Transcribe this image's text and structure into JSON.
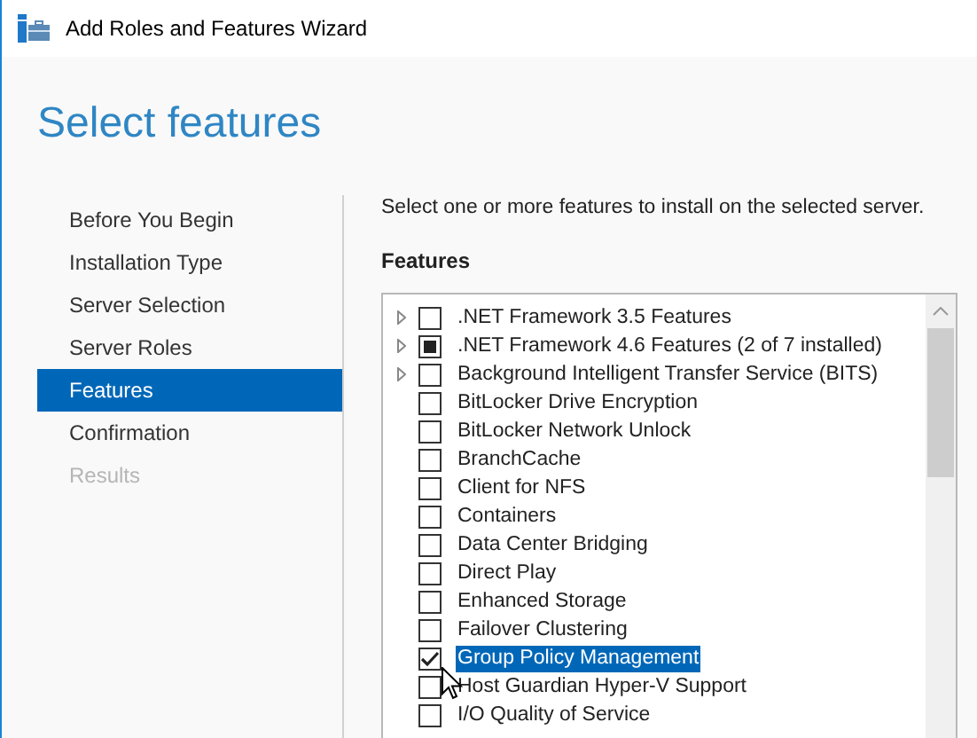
{
  "window": {
    "title": "Add Roles and Features Wizard"
  },
  "heading": "Select features",
  "steps": [
    {
      "label": "Before You Begin",
      "selected": false,
      "disabled": false
    },
    {
      "label": "Installation Type",
      "selected": false,
      "disabled": false
    },
    {
      "label": "Server Selection",
      "selected": false,
      "disabled": false
    },
    {
      "label": "Server Roles",
      "selected": false,
      "disabled": false
    },
    {
      "label": "Features",
      "selected": true,
      "disabled": false
    },
    {
      "label": "Confirmation",
      "selected": false,
      "disabled": false
    },
    {
      "label": "Results",
      "selected": false,
      "disabled": true
    }
  ],
  "description": "Select one or more features to install on the selected server.",
  "features_label": "Features",
  "features": [
    {
      "label": ".NET Framework 3.5 Features",
      "expandable": true,
      "checked": false,
      "partial": false,
      "selected": false
    },
    {
      "label": ".NET Framework 4.6 Features (2 of 7 installed)",
      "expandable": true,
      "checked": false,
      "partial": true,
      "selected": false
    },
    {
      "label": "Background Intelligent Transfer Service (BITS)",
      "expandable": true,
      "checked": false,
      "partial": false,
      "selected": false
    },
    {
      "label": "BitLocker Drive Encryption",
      "expandable": false,
      "checked": false,
      "partial": false,
      "selected": false
    },
    {
      "label": "BitLocker Network Unlock",
      "expandable": false,
      "checked": false,
      "partial": false,
      "selected": false
    },
    {
      "label": "BranchCache",
      "expandable": false,
      "checked": false,
      "partial": false,
      "selected": false
    },
    {
      "label": "Client for NFS",
      "expandable": false,
      "checked": false,
      "partial": false,
      "selected": false
    },
    {
      "label": "Containers",
      "expandable": false,
      "checked": false,
      "partial": false,
      "selected": false
    },
    {
      "label": "Data Center Bridging",
      "expandable": false,
      "checked": false,
      "partial": false,
      "selected": false
    },
    {
      "label": "Direct Play",
      "expandable": false,
      "checked": false,
      "partial": false,
      "selected": false
    },
    {
      "label": "Enhanced Storage",
      "expandable": false,
      "checked": false,
      "partial": false,
      "selected": false
    },
    {
      "label": "Failover Clustering",
      "expandable": false,
      "checked": false,
      "partial": false,
      "selected": false
    },
    {
      "label": "Group Policy Management",
      "expandable": false,
      "checked": true,
      "partial": false,
      "selected": true
    },
    {
      "label": "Host Guardian Hyper-V Support",
      "expandable": false,
      "checked": false,
      "partial": false,
      "selected": false
    },
    {
      "label": "I/O Quality of Service",
      "expandable": false,
      "checked": false,
      "partial": false,
      "selected": false
    }
  ]
}
